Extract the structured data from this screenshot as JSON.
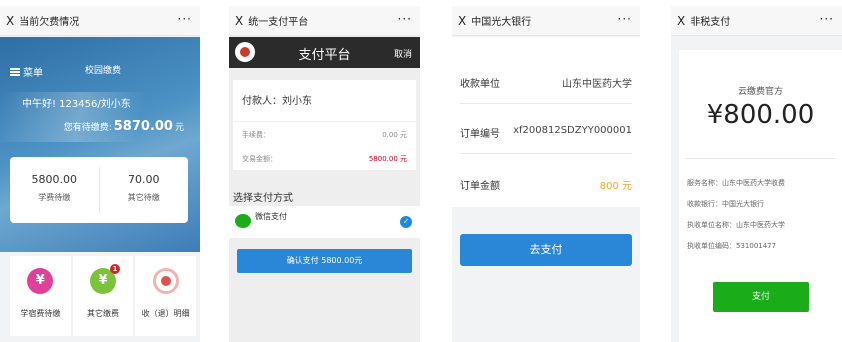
{
  "screens": {
    "s1": {
      "title": "当前欠费情况",
      "close": "X",
      "more": "···",
      "menu_label": "菜单",
      "campus_pay": "校园缴费",
      "greeting": "中午好! 123456/刘小东",
      "pending_label": "您有待缴费:",
      "pending_amount": "5870.00",
      "pending_unit": "元",
      "tuition_amount": "5800.00",
      "tuition_label": "学费待缴",
      "other_amount": "70.00",
      "other_label": "其它待缴",
      "tiles": [
        {
          "label": "学宿费待缴",
          "icon": "yen-icon",
          "color": "#e0409a"
        },
        {
          "label": "其它缴费",
          "icon": "yen-icon",
          "color": "#7bc43a",
          "badge": "1"
        },
        {
          "label": "收（退）明细",
          "icon": "target-icon",
          "color": "#e05050"
        }
      ]
    },
    "s2": {
      "title": "统一支付平台",
      "close": "X",
      "more": "···",
      "header_title": "支付平台",
      "cancel": "取消",
      "payer": "付款人：刘小东",
      "fee_label": "手续费：",
      "fee_value": "0.00 元",
      "amount_label": "交易金额：",
      "amount_value": "5800.00 元",
      "choose_method": "选择支付方式",
      "wechat_pay": "微信支付",
      "confirm": "确认支付 5800.00元"
    },
    "s3": {
      "title": "中国光大银行",
      "close": "X",
      "more": "···",
      "payee_label": "收款单位",
      "payee_value": "山东中医药大学",
      "order_no_label": "订单编号",
      "order_no_value": "xf200812SDZYY000001",
      "order_amount_label": "订单金额",
      "order_amount_value": "800 元",
      "go_pay": "去支付"
    },
    "s4": {
      "title": "非税支付",
      "close": "X",
      "more": "···",
      "merchant": "云缴费官方",
      "amount": "¥800.00",
      "service_name": "服务名称：山东中医药大学收费",
      "bank": "收款银行：中国光大银行",
      "unit_name": "执收单位名称：山东中医药大学",
      "unit_code": "执收单位编码：531001477",
      "pay": "支付"
    }
  },
  "colors": {
    "primary_blue": "#2a86d6",
    "wechat_green": "#1aad19",
    "amount_red": "#d0021b",
    "amount_orange": "#f5a623"
  }
}
